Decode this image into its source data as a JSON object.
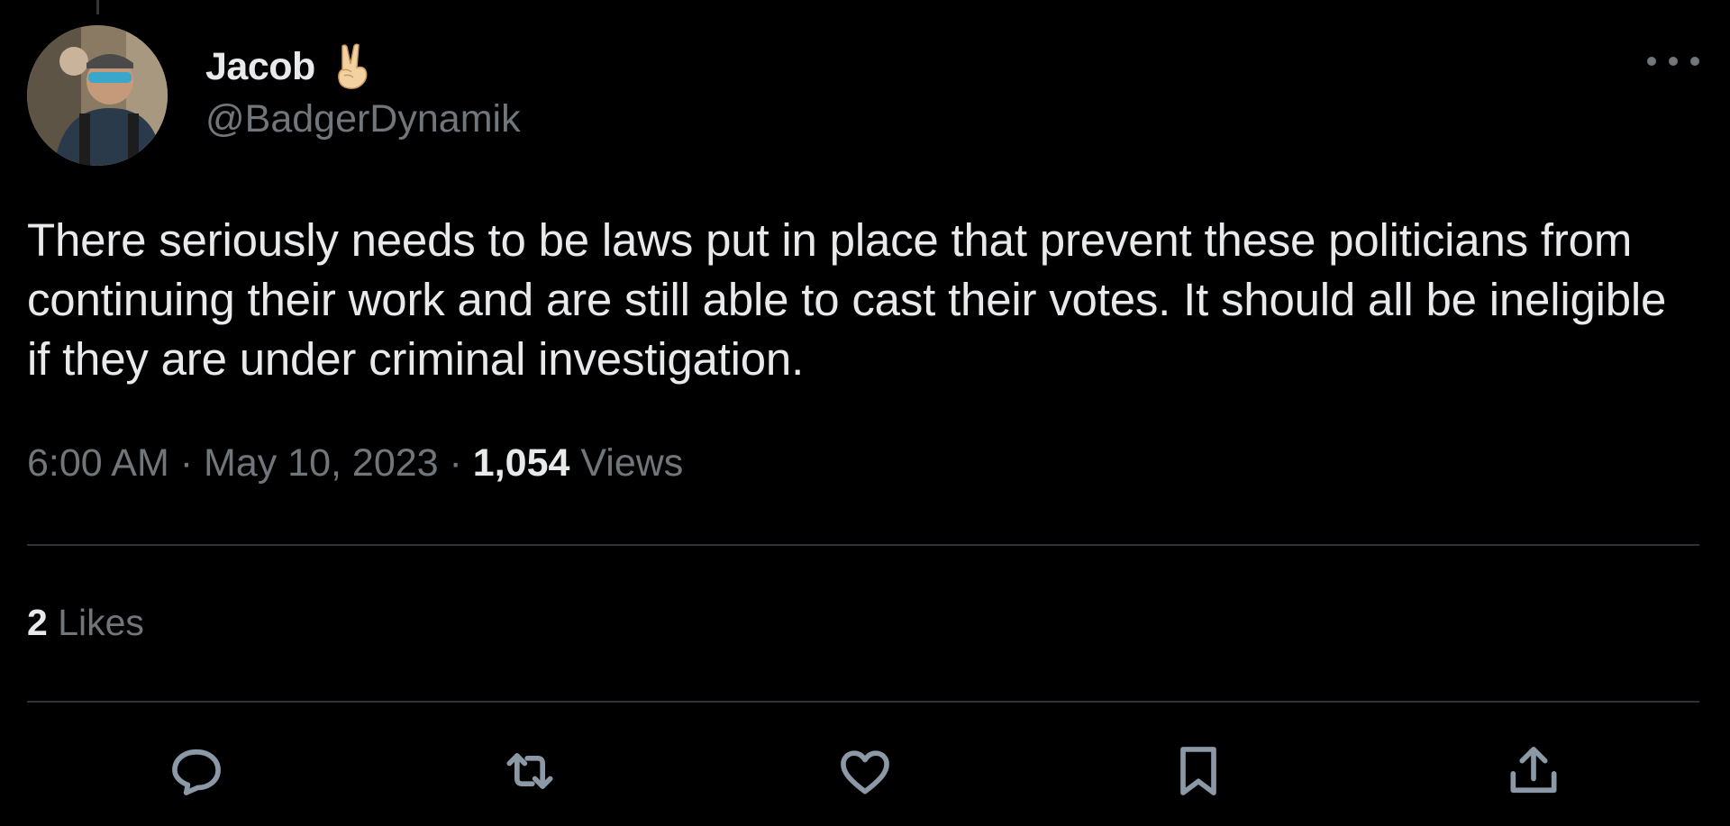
{
  "tweet": {
    "author": {
      "display_name": "Jacob",
      "emoji": "victory-hand-emoji",
      "handle": "@BadgerDynamik"
    },
    "text": "There seriously needs to be laws put in place that prevent these politicians from continuing their work and are still able to cast their votes. It should all be ineligible if they are under criminal investigation.",
    "time": "6:00 AM",
    "separator": "·",
    "date": "May 10, 2023",
    "views_count": "1,054",
    "views_label": "Views",
    "likes_count": "2",
    "likes_label": "Likes"
  },
  "actions": [
    {
      "name": "reply",
      "icon": "reply-icon"
    },
    {
      "name": "retweet",
      "icon": "retweet-icon"
    },
    {
      "name": "like",
      "icon": "heart-icon"
    },
    {
      "name": "bookmark",
      "icon": "bookmark-icon"
    },
    {
      "name": "share",
      "icon": "share-icon"
    }
  ],
  "colors": {
    "background": "#000000",
    "primary_text": "#e7e9ea",
    "secondary_text": "#71767b",
    "divider": "#2f3336",
    "icon": "#8b98a5"
  }
}
